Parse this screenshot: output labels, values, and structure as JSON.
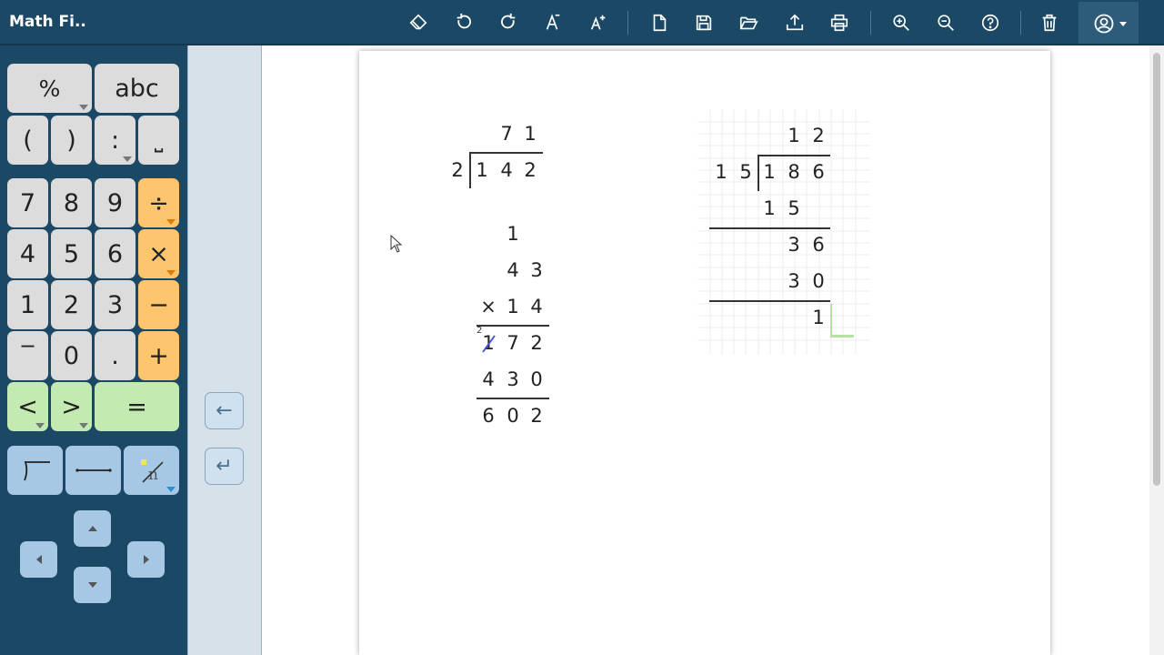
{
  "app": {
    "title": "Math Fi.."
  },
  "toolbar": {
    "icons": [
      "eraser-icon",
      "undo-icon",
      "redo-icon",
      "font-decrease-icon",
      "font-increase-icon",
      "new-file-icon",
      "save-icon",
      "open-folder-icon",
      "upload-icon",
      "print-icon",
      "zoom-in-icon",
      "zoom-out-icon",
      "help-icon",
      "trash-icon",
      "user-icon"
    ]
  },
  "palette": {
    "row1": [
      "%",
      "abc"
    ],
    "row2": [
      "(",
      ")",
      ":",
      "⎵"
    ],
    "digits": [
      [
        "7",
        "8",
        "9"
      ],
      [
        "4",
        "5",
        "6"
      ],
      [
        "1",
        "2",
        "3"
      ]
    ],
    "ops": [
      "÷",
      "×",
      "−",
      "+"
    ],
    "row_bottom": [
      "‾",
      "0",
      "."
    ],
    "compare": [
      "<",
      ">",
      "="
    ],
    "nav": {
      "left_arrow": "←",
      "enter": "↵"
    }
  },
  "colors": {
    "header_bg": "#1b4965",
    "key_gray": "#dcdcdc",
    "key_orange": "#fcc56e",
    "key_green": "#c3eab0",
    "key_blue": "#a6c8e4",
    "strike_blue": "#3b4fd8"
  },
  "worksheet": {
    "division1": {
      "quotient": [
        "7",
        "1"
      ],
      "divisor": "2",
      "dividend": [
        "1",
        "4",
        "2"
      ]
    },
    "multiplication": {
      "carry": "1",
      "top": [
        "4",
        "3"
      ],
      "sign": "×",
      "bottom": [
        "1",
        "4"
      ],
      "partial1": [
        "1",
        "7",
        "2"
      ],
      "partial1_note": "2",
      "partial2": [
        "4",
        "3",
        "0"
      ],
      "result": [
        "6",
        "0",
        "2"
      ]
    },
    "division2": {
      "quotient": [
        "1",
        "2"
      ],
      "divisor": [
        "1",
        "5"
      ],
      "dividend": [
        "1",
        "8",
        "6"
      ],
      "step1": [
        "1",
        "5"
      ],
      "step2": [
        "3",
        "6"
      ],
      "step3": [
        "3",
        "0"
      ],
      "remainder": "1"
    }
  }
}
